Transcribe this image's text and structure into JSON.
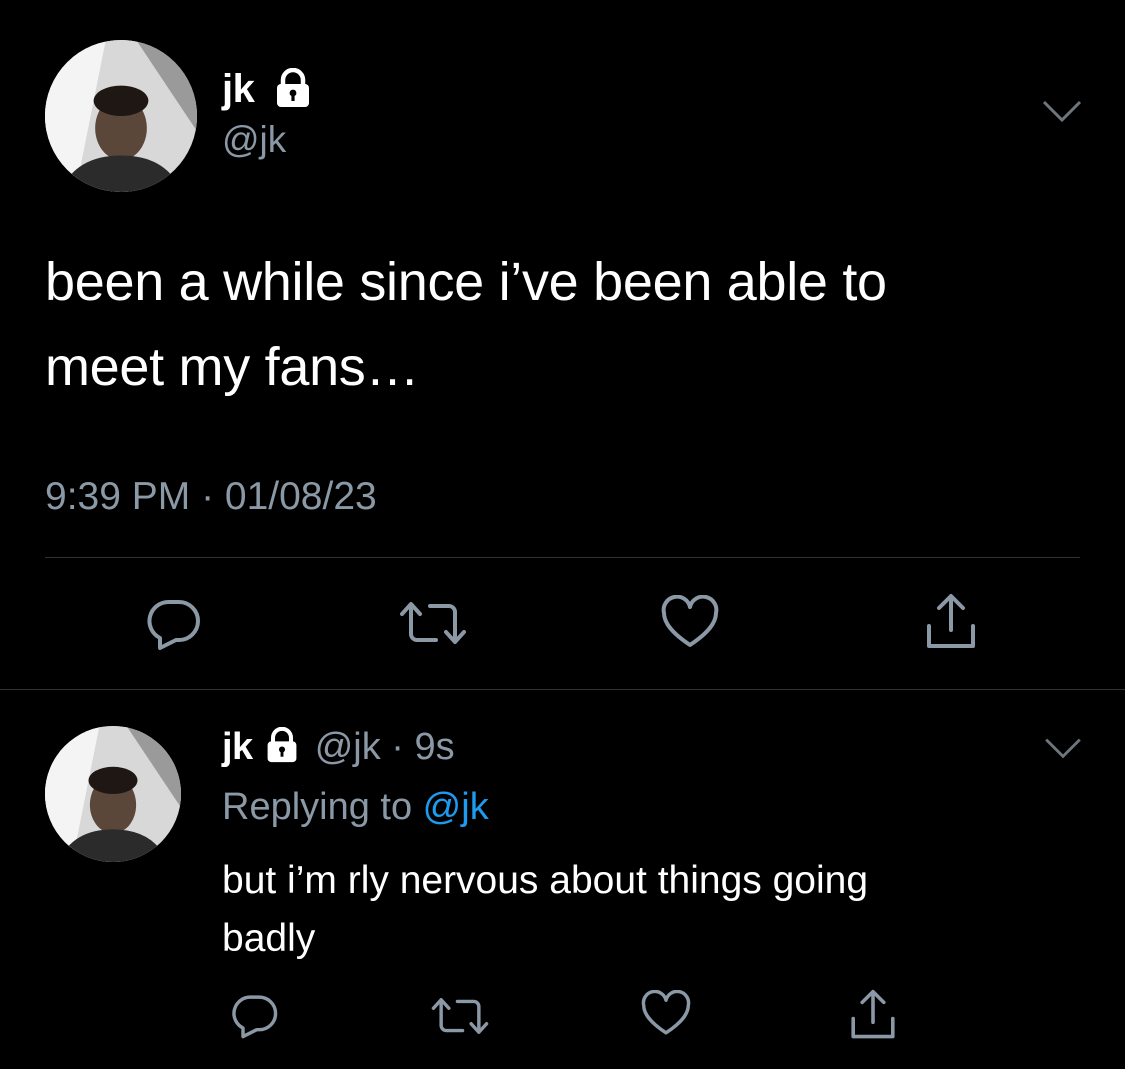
{
  "main_tweet": {
    "display_name": "jk",
    "handle": "@jk",
    "text_line1": "been a while since i’ve been able to",
    "text_line2": "meet my fans…",
    "timestamp": "9:39 PM · 01/08/23",
    "icons": {
      "lock": "lock-icon",
      "more": "chevron-down-icon",
      "reply": "reply-icon",
      "retweet": "retweet-icon",
      "like": "heart-icon",
      "share": "share-icon"
    }
  },
  "reply_tweet": {
    "display_name": "jk",
    "handle_time": "@jk · 9s",
    "replying_prefix": "Replying to ",
    "replying_mention": "@jk",
    "text_line1": "but i’m rly nervous about things going",
    "text_line2": "badly"
  },
  "colors": {
    "background": "#000000",
    "primary_text": "#ffffff",
    "secondary_text": "#8b98a5",
    "link": "#1d9bf0",
    "divider": "#2f3336"
  }
}
